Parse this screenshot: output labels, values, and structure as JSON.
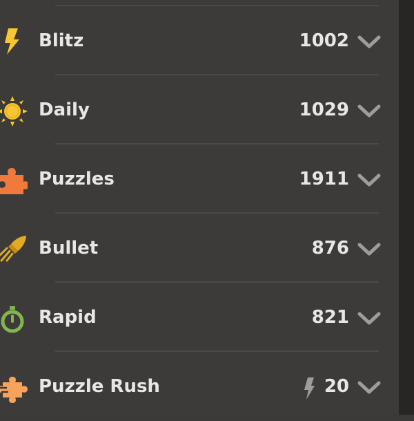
{
  "stats": {
    "rows": [
      {
        "label": "Blitz",
        "value": "1002",
        "icon": "lightning-bolt-icon",
        "icon_color": "#f7c631"
      },
      {
        "label": "Daily",
        "value": "1029",
        "icon": "sun-icon",
        "icon_color": "#f7c631"
      },
      {
        "label": "Puzzles",
        "value": "1911",
        "icon": "puzzle-piece-icon",
        "icon_color": "#f1793b"
      },
      {
        "label": "Bullet",
        "value": "876",
        "icon": "bullet-rocket-icon",
        "icon_color": "#e3aa24"
      },
      {
        "label": "Rapid",
        "value": "821",
        "icon": "stopwatch-icon",
        "icon_color": "#81b64c"
      },
      {
        "label": "Puzzle Rush",
        "value": "20",
        "icon": "puzzle-rush-icon",
        "icon_color": "#f7a35c",
        "value_icon": "bolt-icon"
      }
    ]
  },
  "colors": {
    "background": "#3c3b39",
    "divider": "#4b4a47",
    "text": "#e8e7e5",
    "chevron": "#9e9d9b",
    "scrollbar_track": "#272624"
  }
}
